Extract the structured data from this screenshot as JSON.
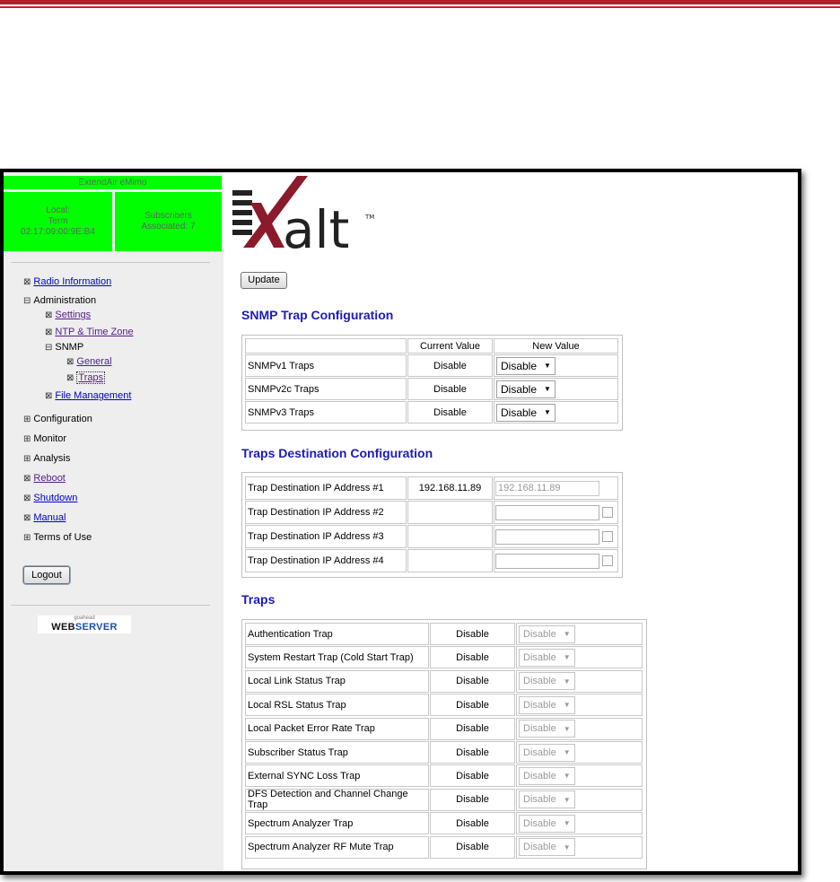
{
  "header_band": {
    "colors": {
      "bar": "#b3202a"
    }
  },
  "status": {
    "title": "ExtendAir eMimo",
    "local": {
      "line1": "Local:",
      "line2": "Term",
      "line3": "02:17:09:00:9E:B4"
    },
    "subscribers": {
      "line1": "Subscribers",
      "line2": "Associated: 7"
    },
    "color": "#00ff00"
  },
  "nav": {
    "radio_information": "Radio Information",
    "administration": "Administration",
    "settings": "Settings",
    "ntp_time_zone": "NTP & Time Zone",
    "snmp": "SNMP",
    "general": "General",
    "traps": "Traps",
    "file_management": "File Management",
    "configuration": "Configuration",
    "monitor": "Monitor",
    "analysis": "Analysis",
    "reboot": "Reboot",
    "shutdown": "Shutdown",
    "manual": "Manual",
    "terms_of_use": "Terms of Use"
  },
  "logout_label": "Logout",
  "webserver_badge": {
    "small": "goahead",
    "web": "WEB",
    "server": "SERVER"
  },
  "logo": {
    "text": "alt",
    "tm": "TM",
    "colors": {
      "mark": "#8b1a2b",
      "text": "#222222"
    }
  },
  "update_label": "Update",
  "snmp_trap_config": {
    "title": "SNMP Trap Configuration",
    "headers": [
      "",
      "Current Value",
      "New Value"
    ],
    "rows": [
      {
        "label": "SNMPv1 Traps",
        "current": "Disable",
        "new": "Disable"
      },
      {
        "label": "SNMPv2c Traps",
        "current": "Disable",
        "new": "Disable"
      },
      {
        "label": "SNMPv3 Traps",
        "current": "Disable",
        "new": "Disable"
      }
    ]
  },
  "traps_destination": {
    "title": "Traps Destination Configuration",
    "rows": [
      {
        "label": "Trap Destination IP Address #1",
        "current": "192.168.11.89",
        "new": "192.168.11.89"
      },
      {
        "label": "Trap Destination IP Address #2",
        "current": "",
        "new": ""
      },
      {
        "label": "Trap Destination IP Address #3",
        "current": "",
        "new": ""
      },
      {
        "label": "Trap Destination IP Address #4",
        "current": "",
        "new": ""
      }
    ]
  },
  "traps": {
    "title": "Traps",
    "rows": [
      {
        "label": "Authentication Trap",
        "current": "Disable",
        "new": "Disable"
      },
      {
        "label": "System Restart Trap (Cold Start Trap)",
        "current": "Disable",
        "new": "Disable"
      },
      {
        "label": "Local Link Status Trap",
        "current": "Disable",
        "new": "Disable"
      },
      {
        "label": "Local RSL Status Trap",
        "current": "Disable",
        "new": "Disable"
      },
      {
        "label": "Local Packet Error Rate Trap",
        "current": "Disable",
        "new": "Disable"
      },
      {
        "label": "Subscriber Status Trap",
        "current": "Disable",
        "new": "Disable"
      },
      {
        "label": "External SYNC Loss Trap",
        "current": "Disable",
        "new": "Disable"
      },
      {
        "label": "DFS Detection and Channel Change Trap",
        "current": "Disable",
        "new": "Disable"
      },
      {
        "label": "Spectrum Analyzer Trap",
        "current": "Disable",
        "new": "Disable"
      },
      {
        "label": "Spectrum Analyzer RF Mute Trap",
        "current": "Disable",
        "new": "Disable"
      }
    ]
  }
}
